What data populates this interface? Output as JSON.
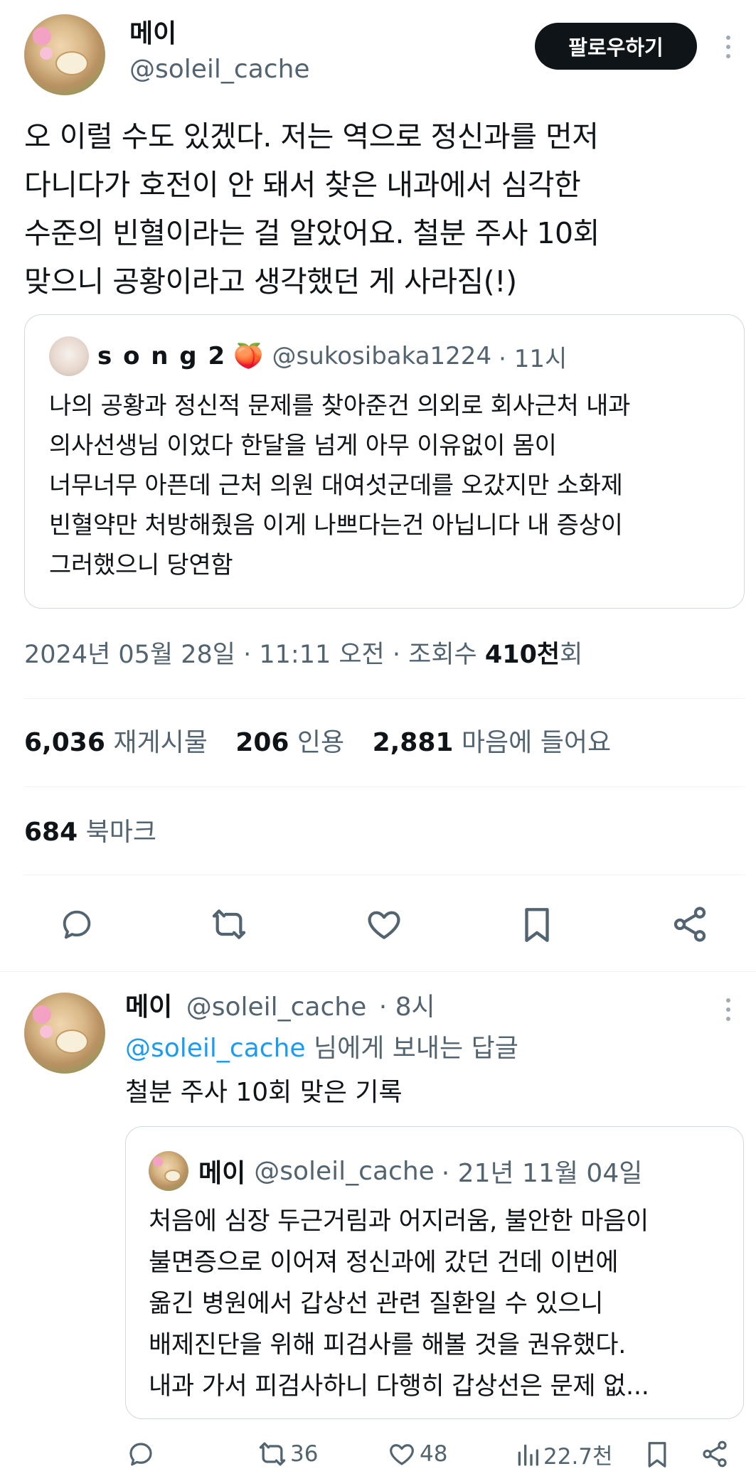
{
  "main_post": {
    "display_name": "메이",
    "handle": "@soleil_cache",
    "follow_label": "팔로우하기",
    "text_lines": [
      "오 이럴 수도 있겠다. 저는 역으로 정신과를 먼저",
      "다니다가 호전이 안 돼서 찾은 내과에서 심각한",
      "수준의 빈혈이라는 걸 알았어요. 철분 주사 10회",
      "맞으니 공황이라고 생각했던 게 사라짐(!)"
    ],
    "quote": {
      "display_name": "s o n g 2",
      "emoji": "🍑",
      "handle": "@sukosibaka1224",
      "time": "· 11시",
      "text_lines": [
        "나의 공황과 정신적 문제를 찾아준건 의외로 회사근처 내과",
        "의사선생님 이었다 한달을 넘게 아무 이유없이 몸이",
        "너무너무 아픈데 근처 의원 대여섯군데를 오갔지만 소화제",
        "빈혈약만 처방해줬음 이게 나쁘다는건 아닙니다 내 증상이",
        "그러했으니 당연함"
      ]
    },
    "meta": {
      "datetime": "2024년 05월 28일 · 11:11 오전 · 조회수 ",
      "views": "410천",
      "views_suffix": "회"
    },
    "stats": {
      "reposts": "6,036",
      "reposts_label": "재게시물",
      "quotes": "206",
      "quotes_label": "인용",
      "likes": "2,881",
      "likes_label": "마음에 들어요",
      "bookmarks": "684",
      "bookmarks_label": "북마크"
    }
  },
  "reply": {
    "display_name": "메이",
    "handle": "@soleil_cache",
    "time": "· 8시",
    "reply_to_handle": "@soleil_cache",
    "reply_to_suffix": " 님에게 보내는 답글",
    "text": "철분 주사 10회 맞은 기록",
    "quote": {
      "display_name": "메이",
      "handle": "@soleil_cache",
      "time": "· 21년 11월 04일",
      "text_lines": [
        "처음에 심장 두근거림과 어지러움, 불안한 마음이",
        "불면증으로 이어져 정신과에 갔던 건데 이번에",
        "옮긴 병원에서 갑상선 관련 질환일 수 있으니",
        "배제진단을 위해 피검사를 해볼 것을 권유했다.",
        "내과 가서 피검사하니 다행히 갑상선은 문제 없..."
      ]
    },
    "actions": {
      "retweets": "36",
      "likes": "48",
      "views": "22.7천"
    }
  },
  "icons": {
    "reply": "comment-icon",
    "retweet": "retweet-icon",
    "like": "heart-icon",
    "bookmark": "bookmark-icon",
    "share": "share-icon",
    "views": "analytics-icon",
    "more": "more-vertical-icon"
  },
  "colors": {
    "text": "#0f1419",
    "muted": "#536471",
    "link": "#1d9bf0",
    "border": "#cfd9de",
    "divider": "#eff3f4",
    "button": "#0f1419"
  }
}
